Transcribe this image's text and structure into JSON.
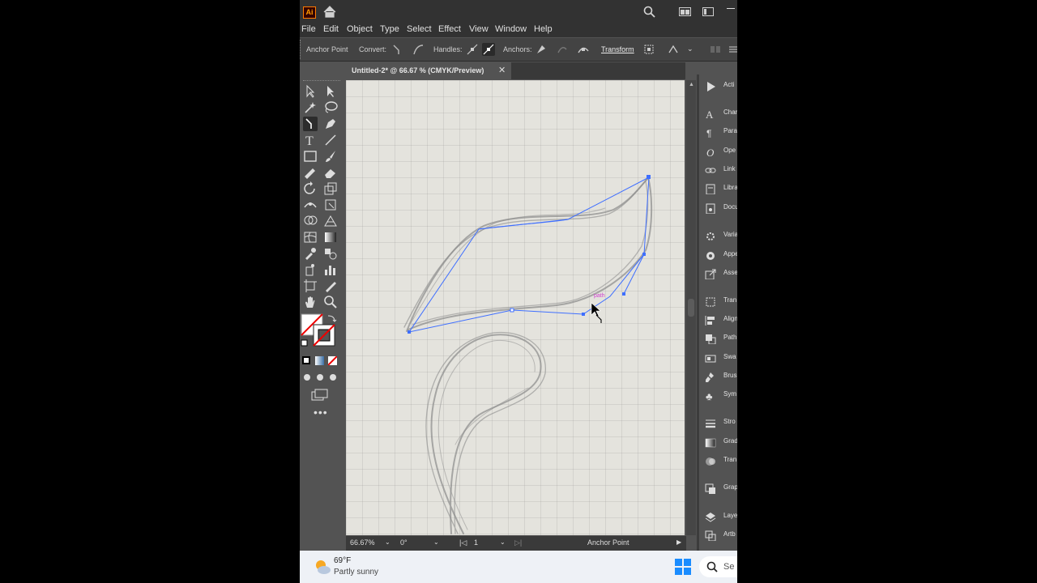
{
  "menu": [
    "File",
    "Edit",
    "Object",
    "Type",
    "Select",
    "Effect",
    "View",
    "Window",
    "Help"
  ],
  "control_bar": {
    "tool_label": "Anchor Point",
    "convert_label": "Convert:",
    "handles_label": "Handles:",
    "anchors_label": "Anchors:",
    "transform_label": "Transform"
  },
  "document_tab": {
    "title": "Untitled-2* @ 66.67 % (CMYK/Preview)",
    "close": "✕"
  },
  "status_bar": {
    "zoom": "66.67%",
    "rotation": "0°",
    "artboard": "1",
    "tool": "Anchor Point"
  },
  "right_panels": [
    "Acti",
    "Char",
    "Para",
    "Ope",
    "Link",
    "Libra",
    "Docu",
    "Varia",
    "Appe",
    "Asse",
    "Tran",
    "Align",
    "Path",
    "Swa",
    "Brus",
    "Sym",
    "Stro",
    "Grad",
    "Tran",
    "Grap",
    "Laye",
    "Artb"
  ],
  "taskbar": {
    "temperature": "69°F",
    "condition": "Partly sunny",
    "search_label": "Se"
  },
  "colors": {
    "accent_path": "#3f6fff",
    "ai_logo": "#ff9a00"
  }
}
